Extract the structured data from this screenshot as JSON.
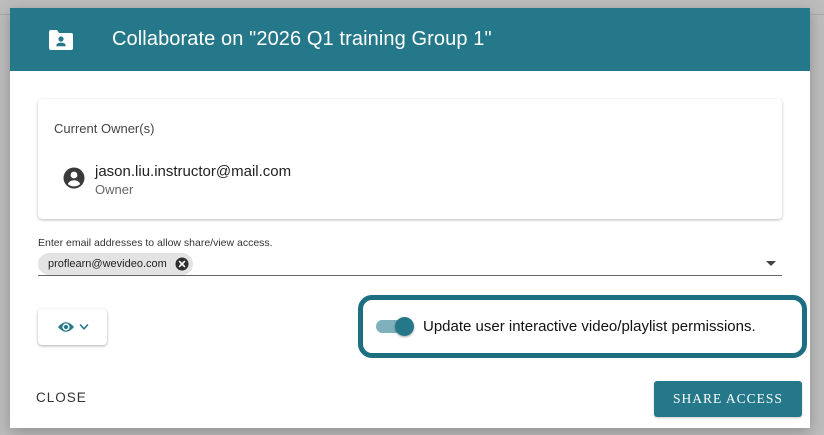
{
  "dialog": {
    "title": "Collaborate on \"2026 Q1 training Group 1\"",
    "header_icon": "folder-shared-icon",
    "header_color": "#25788a"
  },
  "owners": {
    "label": "Current Owner(s)",
    "items": [
      {
        "email": "jason.liu.instructor@mail.com",
        "role": "Owner",
        "icon": "account-circle-icon"
      }
    ]
  },
  "share_input": {
    "label": "Enter email addresses to allow share/view access.",
    "chips": [
      {
        "email": "proflearn@wevideo.com",
        "remove_icon": "close-circle-icon"
      }
    ],
    "dropdown_icon": "arrow-drop-down-icon"
  },
  "permission_button": {
    "icon": "eye-icon",
    "dropdown_icon": "chevron-down-icon"
  },
  "interactive_toggle": {
    "label": "Update user interactive video/playlist permissions.",
    "on": true,
    "highlight_color": "#1d6e81"
  },
  "actions": {
    "close_label": "CLOSE",
    "share_label": "SHARE ACCESS"
  }
}
